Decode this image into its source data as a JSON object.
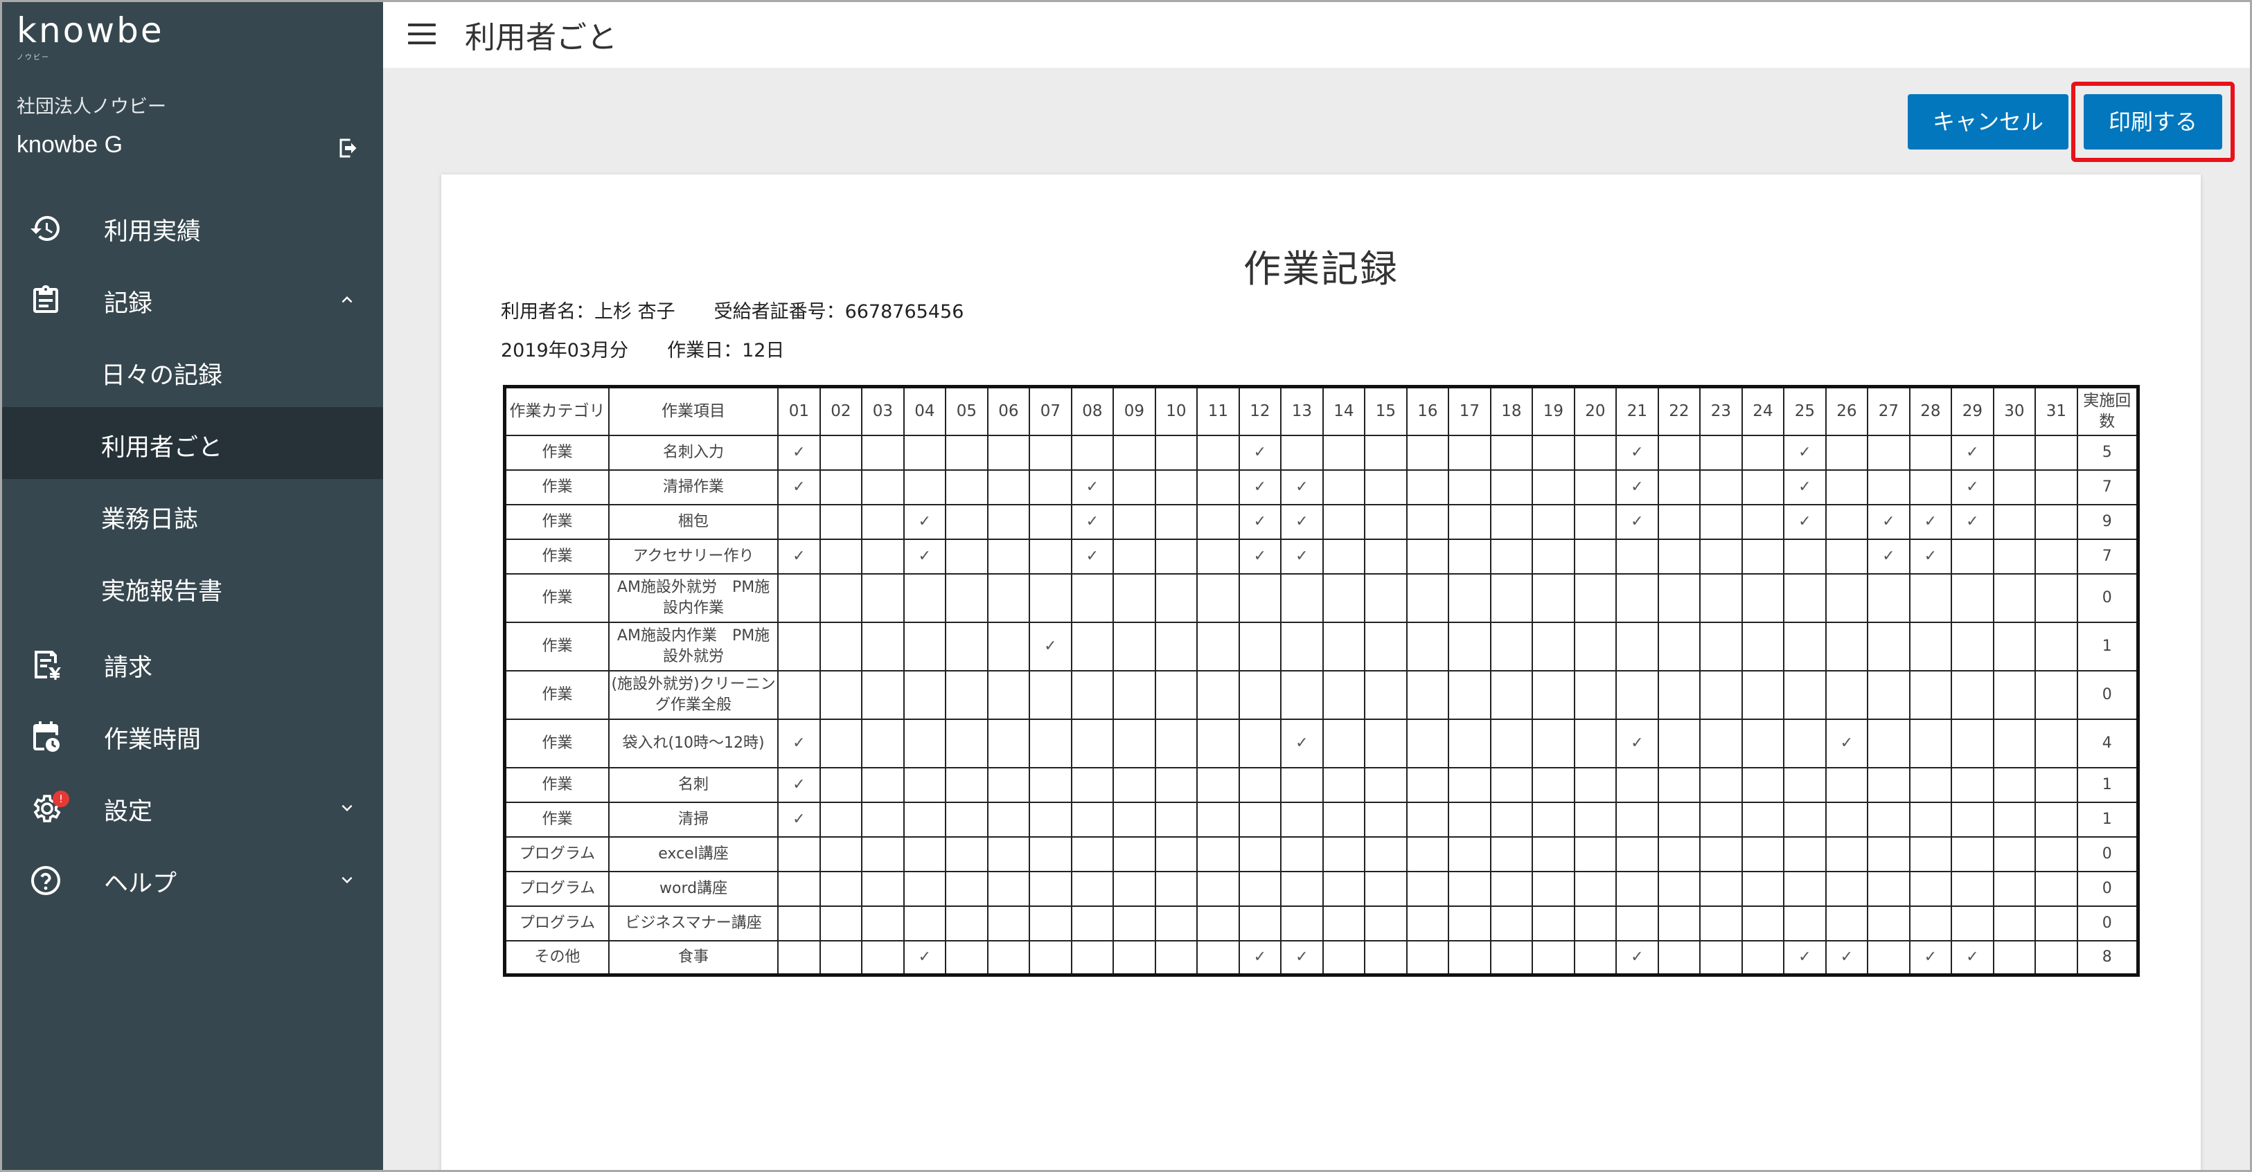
{
  "sidebar": {
    "logo": "knowbe",
    "logo_sub": "ノウビー",
    "org": "社団法人ノウビー",
    "facility": "knowbe G",
    "items": [
      {
        "label": "利用実績",
        "icon": "history-icon"
      },
      {
        "label": "記録",
        "icon": "clipboard-icon"
      },
      {
        "label": "日々の記録"
      },
      {
        "label": "利用者ごと"
      },
      {
        "label": "業務日誌"
      },
      {
        "label": "実施報告書"
      },
      {
        "label": "請求",
        "icon": "invoice-icon"
      },
      {
        "label": "作業時間",
        "icon": "calendar-icon"
      },
      {
        "label": "設定",
        "icon": "gear-icon",
        "badge": "!"
      },
      {
        "label": "ヘルプ",
        "icon": "help-icon"
      }
    ]
  },
  "header": {
    "title": "利用者ごと"
  },
  "actions": {
    "cancel": "キャンセル",
    "print": "印刷する"
  },
  "document": {
    "title": "作業記録",
    "user_label": "利用者名：",
    "user_name": "上杉 杏子",
    "cert_label": "受給者証番号：",
    "cert_no": "6678765456",
    "month": "2019年03月分",
    "workdays_label": "作業日：",
    "workdays": "12日",
    "col_category": "作業カテゴリ",
    "col_item": "作業項目",
    "col_count": "実施回数",
    "days": [
      "01",
      "02",
      "03",
      "04",
      "05",
      "06",
      "07",
      "08",
      "09",
      "10",
      "11",
      "12",
      "13",
      "14",
      "15",
      "16",
      "17",
      "18",
      "19",
      "20",
      "21",
      "22",
      "23",
      "24",
      "25",
      "26",
      "27",
      "28",
      "29",
      "30",
      "31"
    ],
    "check_mark": "✓",
    "rows": [
      {
        "category": "作業",
        "item": "名刺入力",
        "checks": [
          1,
          12,
          21,
          25,
          29
        ],
        "count": "5"
      },
      {
        "category": "作業",
        "item": "清掃作業",
        "checks": [
          1,
          8,
          12,
          13,
          21,
          25,
          29
        ],
        "count": "7"
      },
      {
        "category": "作業",
        "item": "梱包",
        "checks": [
          4,
          8,
          12,
          13,
          21,
          25,
          27,
          28,
          29
        ],
        "count": "9"
      },
      {
        "category": "作業",
        "item": "アクセサリー作り",
        "checks": [
          1,
          4,
          8,
          12,
          13,
          27,
          28
        ],
        "count": "7"
      },
      {
        "category": "作業",
        "item": "AM施設外就労　PM施設内作業",
        "checks": [],
        "count": "0"
      },
      {
        "category": "作業",
        "item": "AM施設内作業　PM施設外就労",
        "checks": [
          7
        ],
        "count": "1"
      },
      {
        "category": "作業",
        "item": "(施設外就労)クリーニング作業全般",
        "checks": [],
        "count": "0"
      },
      {
        "category": "作業",
        "item": "袋入れ(10時～12時)",
        "checks": [
          1,
          13,
          21,
          26
        ],
        "count": "4"
      },
      {
        "category": "作業",
        "item": "名刺",
        "checks": [
          1
        ],
        "count": "1"
      },
      {
        "category": "作業",
        "item": "清掃",
        "checks": [
          1
        ],
        "count": "1"
      },
      {
        "category": "プログラム",
        "item": "excel講座",
        "checks": [],
        "count": "0"
      },
      {
        "category": "プログラム",
        "item": "word講座",
        "checks": [],
        "count": "0"
      },
      {
        "category": "プログラム",
        "item": "ビジネスマナー講座",
        "checks": [],
        "count": "0"
      },
      {
        "category": "その他",
        "item": "食事",
        "checks": [
          4,
          12,
          13,
          21,
          25,
          26,
          28,
          29
        ],
        "count": "8"
      }
    ]
  }
}
